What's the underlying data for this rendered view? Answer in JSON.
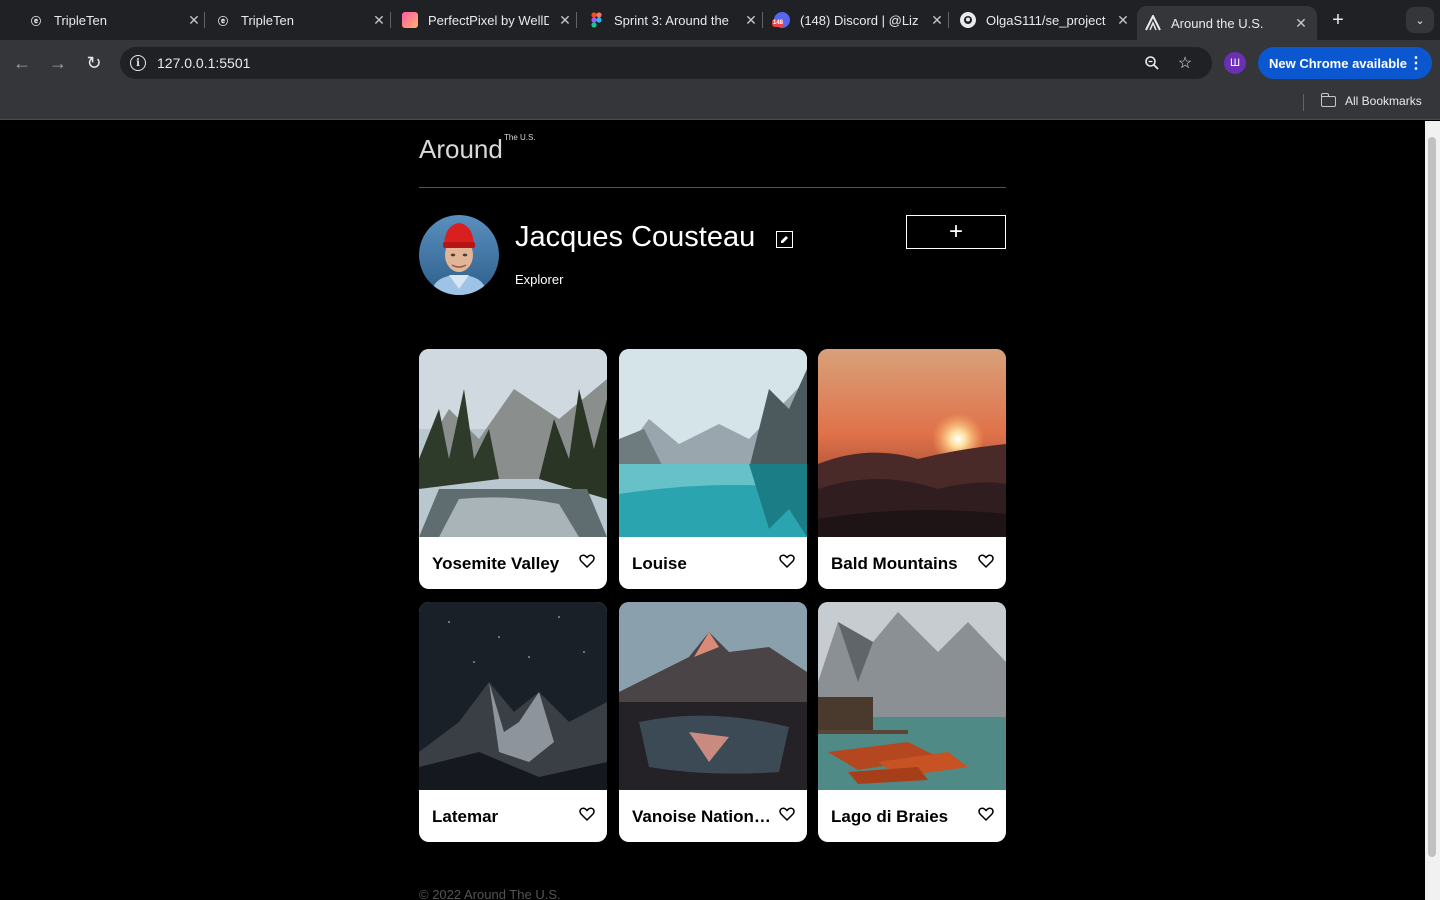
{
  "browser": {
    "tabs": [
      {
        "title": "TripleTen",
        "favicon": "tripleten-icon"
      },
      {
        "title": "TripleTen",
        "favicon": "tripleten-icon"
      },
      {
        "title": "PerfectPixel by WellD",
        "favicon": "perfectpixel-icon"
      },
      {
        "title": "Sprint 3: Around the",
        "favicon": "figma-icon"
      },
      {
        "title": "(148) Discord | @Liz",
        "favicon": "discord-icon",
        "badge": "148"
      },
      {
        "title": "OlgaS111/se_project",
        "favicon": "github-icon"
      },
      {
        "title": "Around the U.S.",
        "favicon": "around-icon",
        "active": true
      }
    ],
    "url": "127.0.0.1:5501",
    "profile_initial": "Ш",
    "update_label": "New Chrome available",
    "bookmarks_label": "All Bookmarks"
  },
  "header": {
    "logo": "Around",
    "logo_sup": "The U.S."
  },
  "profile": {
    "name": "Jacques Cousteau",
    "job": "Explorer",
    "add_label": "+"
  },
  "cards": [
    {
      "title": "Yosemite Valley"
    },
    {
      "title": "Louise"
    },
    {
      "title": "Bald Mountains"
    },
    {
      "title": "Latemar"
    },
    {
      "title": "Vanoise National Park"
    },
    {
      "title": "Lago di Braies"
    }
  ],
  "footer": {
    "text": "© 2022 Around The U.S."
  }
}
